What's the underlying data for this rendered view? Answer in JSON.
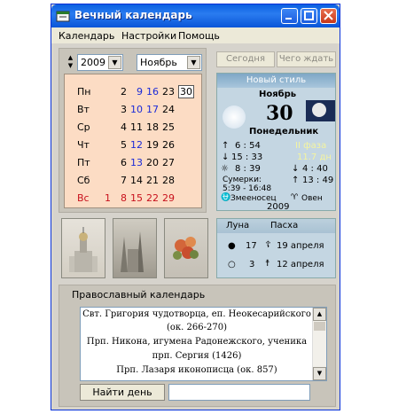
{
  "window": {
    "title": "Вечный календарь"
  },
  "menu": {
    "items": [
      "Календарь",
      "Настройки",
      "Помощь"
    ]
  },
  "selectors": {
    "year": "2009",
    "month": "Ноябрь"
  },
  "calendar": {
    "weekdays": [
      "Пн",
      "Вт",
      "Ср",
      "Чт",
      "Пт",
      "Сб",
      "Вс"
    ],
    "rows": [
      [
        "",
        "2",
        "9",
        "16",
        "23",
        "30"
      ],
      [
        "",
        "3",
        "10",
        "17",
        "24",
        ""
      ],
      [
        "",
        "4",
        "11",
        "18",
        "25",
        ""
      ],
      [
        "",
        "5",
        "12",
        "19",
        "26",
        ""
      ],
      [
        "",
        "6",
        "13",
        "20",
        "27",
        ""
      ],
      [
        "",
        "7",
        "14",
        "21",
        "28",
        ""
      ],
      [
        "1",
        "8",
        "15",
        "22",
        "29",
        ""
      ]
    ]
  },
  "buttons": {
    "today": "Сегодня",
    "what_to_expect": "Чего ждать"
  },
  "info": {
    "style": "Новый стиль",
    "month": "Ноябрь",
    "day": "30",
    "weekday": "Понедельник",
    "sunrise": "6 : 54",
    "sunset": "15 : 33",
    "day_length": "8 : 39",
    "moon_phase": "II фаза",
    "moon_age": "11.7 дн",
    "moonset": "4 : 40",
    "moonrise": "13 : 49",
    "twilight_label": "Сумерки:",
    "twilight": "5:39 - 16:48",
    "zodiac_left": "Змееносец",
    "zodiac_right": "Овен",
    "year": "2009"
  },
  "moon_easter": {
    "moon_header": "Луна",
    "easter_header": "Пасха",
    "row1_moon": "17",
    "row1_easter": "19 апреля",
    "row2_moon": "3",
    "row2_easter": "12 апреля"
  },
  "orthodox": {
    "label": "Православный календарь",
    "lines": [
      "Свт. Григория чудотворца, еп. Неокесарийского",
      "(ок. 266-270)",
      "Прп. Никона, игумена Радонежского, ученика",
      "прп. Сергия (1426)",
      "Прп. Лазаря иконописца (ок. 857)"
    ],
    "find_button": "Найти день"
  }
}
